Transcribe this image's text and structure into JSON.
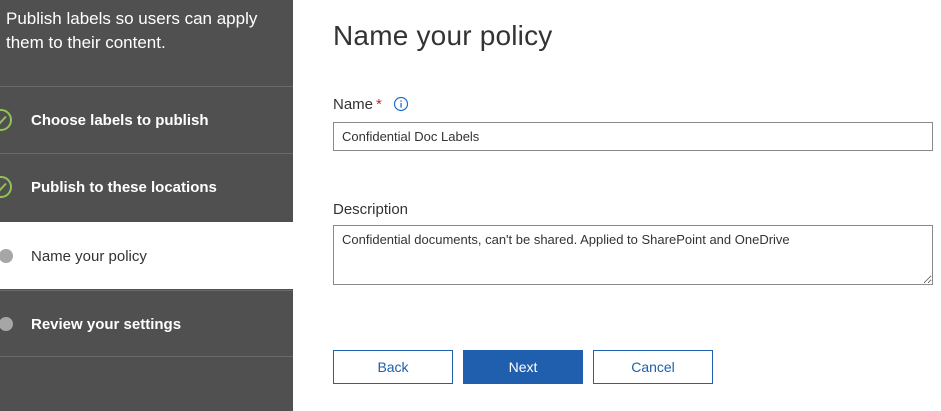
{
  "sidebar": {
    "intro": "Publish labels so users can apply them to their content.",
    "steps": [
      {
        "label": "Choose labels to publish",
        "status": "complete"
      },
      {
        "label": "Publish to these locations",
        "status": "complete"
      },
      {
        "label": "Name your policy",
        "status": "current"
      },
      {
        "label": "Review your settings",
        "status": "pending"
      }
    ]
  },
  "main": {
    "title": "Name your policy",
    "name_field": {
      "label": "Name",
      "required_marker": "*",
      "info_icon": "info-icon",
      "value": "Confidential Doc Labels"
    },
    "description_field": {
      "label": "Description",
      "value": "Confidential documents, can't be shared. Applied to SharePoint and OneDrive"
    }
  },
  "buttons": {
    "back_label": "Back",
    "next_label": "Next",
    "cancel_label": "Cancel"
  },
  "colors": {
    "sidebar_bg": "#505050",
    "complete_check": "#92c353",
    "primary": "#1f5fad",
    "required": "#c4262e"
  }
}
